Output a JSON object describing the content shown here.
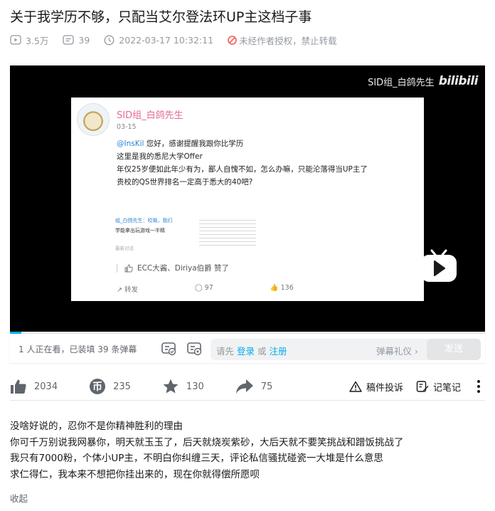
{
  "video": {
    "title": "关于我学历不够，只配当艾尔登法环UP主这档子事",
    "views": "3.5万",
    "danmaku_count": "39",
    "publish_time": "2022-03-17 10:32:11",
    "copyright_notice": "未经作者授权，禁止转载"
  },
  "player": {
    "watermark_name": "SID组_白鸽先生",
    "watermark_logo": "bilibili",
    "progress": 0.024,
    "screenshot": {
      "username": "SID组_白鸽先生",
      "date": "03-15",
      "mention": "@InsKil",
      "line1": " 您好，感谢提醒我跟你比学历",
      "line2": "这里是我的悉尼大学Offer",
      "line3": "年仅25岁便如此年少有为，鄙人自愧不如，怎么办嘛，只能沦落得当UP主了",
      "line4": "贵校的QS世界排名一定高于悉大的40吧?",
      "mini_line1": "组_白鸽先生：哎呦，我们",
      "mini_line2": "学能拿出玩游戏一半精",
      "mini_line3": "最新对话",
      "likes_text": "ECC大酱、Diriya伯爵 赞了",
      "share_label": "转发",
      "comment_count": "97",
      "like_count": "136"
    }
  },
  "danmaku_bar": {
    "watching": "1 人正在看，已装填 39 条弹幕",
    "placeholder_prefix": "请先 ",
    "login": "登录",
    "or": " 或 ",
    "register": "注册",
    "etiquette": "弹幕礼仪 ›",
    "send": "发送"
  },
  "toolbar": {
    "like_count": "2034",
    "coin_count": "235",
    "favorite_count": "130",
    "share_count": "75",
    "report": "稿件投诉",
    "notes": "记笔记"
  },
  "description": {
    "lines": [
      "没啥好说的，忍你不是你精神胜利的理由",
      "你可千万别说我网暴你，明天就玉玉了，后天就烧炭紫砂，大后天就不要笑挑战和蹭饭挑战了",
      "我只有7000粉，个体小UP主，不明白你纠缠三天，评论私信骚扰碰瓷一大堆是什么意思",
      "求仁得仁，我本来不想把你挂出来的，现在你就得偿所愿呗"
    ],
    "collapse": "收起"
  },
  "colors": {
    "accent": "#00aeec",
    "text_main": "#18191c",
    "text_muted": "#9499a0",
    "screenshot_name": "#e66a93"
  }
}
